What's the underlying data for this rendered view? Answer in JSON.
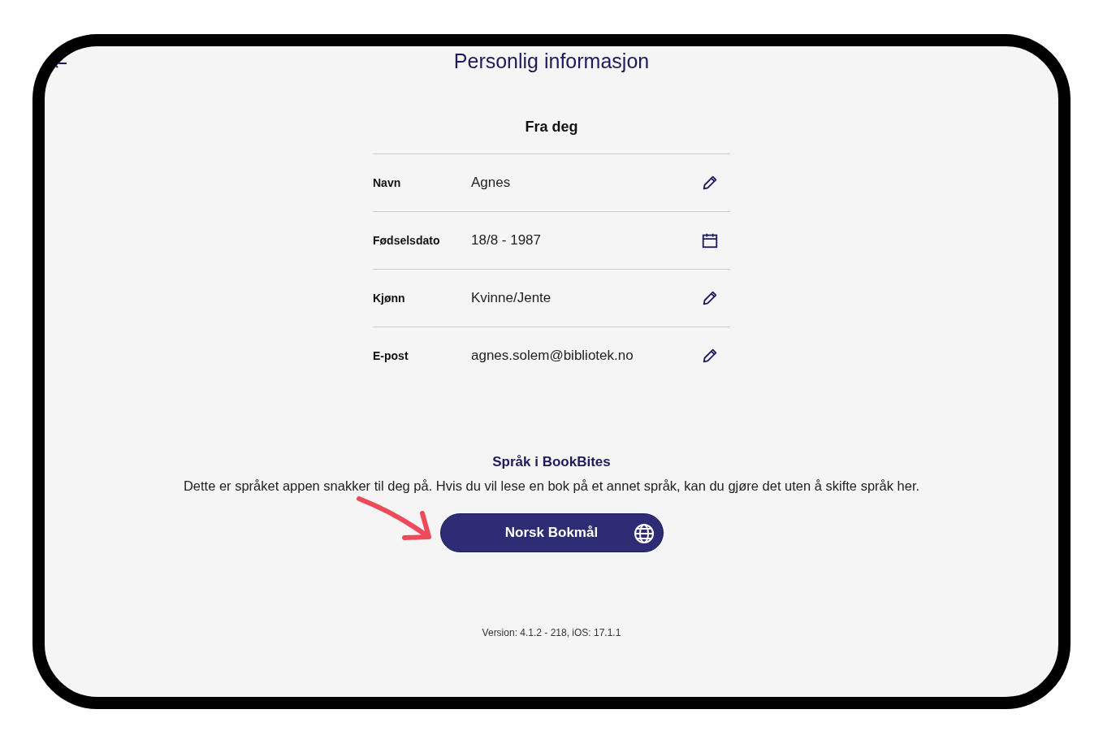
{
  "header": {
    "title": "Personlig informasjon"
  },
  "profile": {
    "heading": "Fra deg",
    "rows": [
      {
        "label": "Navn",
        "value": "Agnes",
        "kind": "edit"
      },
      {
        "label": "Fødselsdato",
        "value": "18/8 - 1987",
        "kind": "date"
      },
      {
        "label": "Kjønn",
        "value": "Kvinne/Jente",
        "kind": "edit"
      },
      {
        "label": "E-post",
        "value": "agnes.solem@bibliotek.no",
        "kind": "edit"
      }
    ]
  },
  "language": {
    "heading": "Språk i BookBites",
    "description": "Dette er språket appen snakker til deg på. Hvis du vil lese en bok på et annet språk, kan du gjøre det uten å skifte språk her.",
    "button": "Norsk Bokmål"
  },
  "footer": {
    "version": "Version: 4.1.2 - 218, iOS: 17.1.1"
  }
}
